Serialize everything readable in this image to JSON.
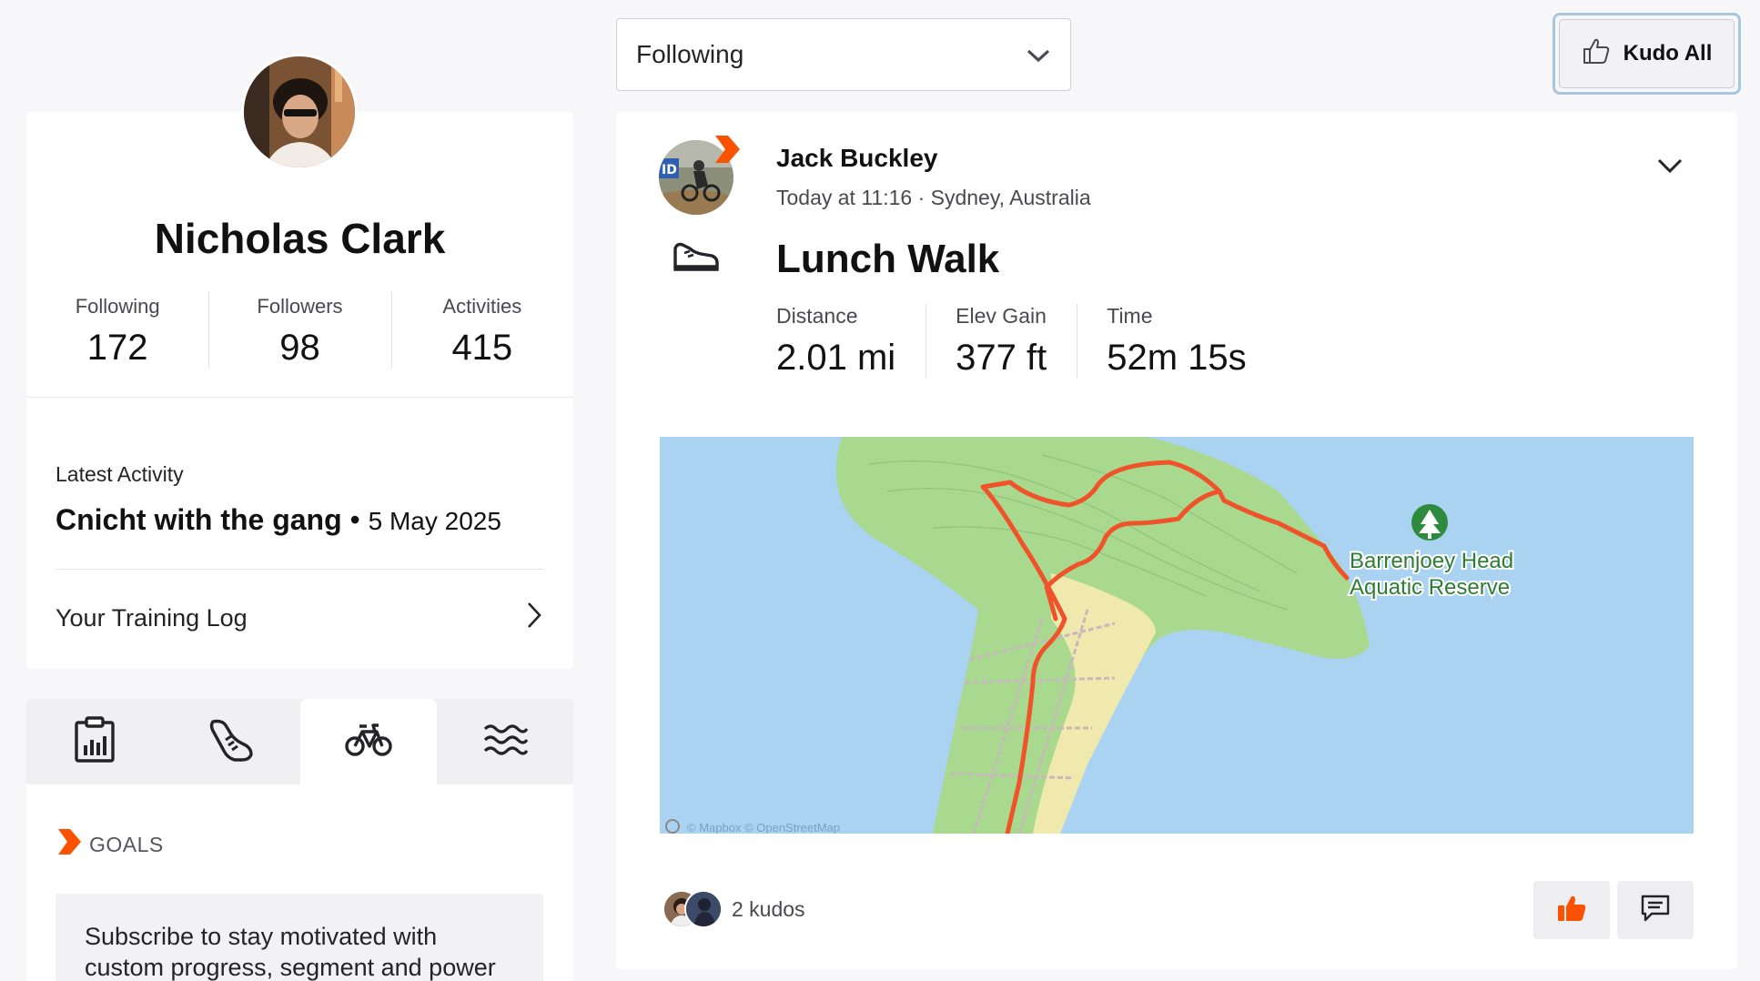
{
  "profile": {
    "name": "Nicholas Clark",
    "stats": [
      {
        "label": "Following",
        "value": "172"
      },
      {
        "label": "Followers",
        "value": "98"
      },
      {
        "label": "Activities",
        "value": "415"
      }
    ],
    "latest_activity_label": "Latest Activity",
    "latest_activity_name": "Cnicht with the gang",
    "latest_activity_separator": "•",
    "latest_activity_date": "5 May 2025",
    "training_log_label": "Your Training Log"
  },
  "sport_tabs": [
    {
      "icon": "clipboard-chart-icon",
      "active": false
    },
    {
      "icon": "running-shoe-icon",
      "active": false
    },
    {
      "icon": "bike-icon",
      "active": true
    },
    {
      "icon": "swim-icon",
      "active": false
    }
  ],
  "goals": {
    "heading": "GOALS",
    "subscribe_text": "Subscribe to stay motivated with custom progress, segment and power"
  },
  "feed_filter": {
    "selected": "Following"
  },
  "kudo_all_label": "Kudo All",
  "activity": {
    "athlete_name": "Jack Buckley",
    "meta": "Today at 11:16 · Sydney, Australia",
    "sport_icon": "walk-shoe-icon",
    "title": "Lunch Walk",
    "metrics": [
      {
        "label": "Distance",
        "value": "2.01 mi"
      },
      {
        "label": "Elev Gain",
        "value": "377 ft"
      },
      {
        "label": "Time",
        "value": "52m 15s"
      }
    ],
    "map": {
      "place_label_line1": "Barrenjoey Head",
      "place_label_line2": "Aquatic Reserve",
      "attribution": "© Mapbox © OpenStreetMap"
    },
    "kudos_text": "2 kudos"
  },
  "colors": {
    "accent": "#fc5200",
    "route": "#f0522a",
    "water": "#aad3f2",
    "land": "#a9d88f",
    "sand": "#efe9ad"
  }
}
